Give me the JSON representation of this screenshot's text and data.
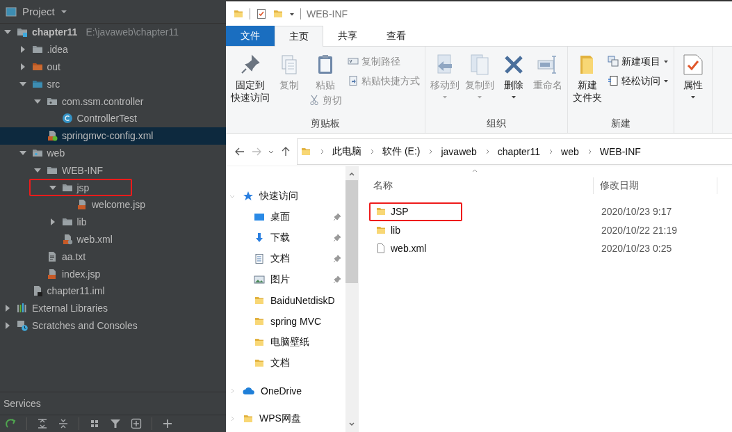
{
  "project_panel": {
    "title": "Project",
    "tree": [
      {
        "label": "chapter11",
        "path": "E:\\javaweb\\chapter11",
        "kind": "module",
        "expanded": true,
        "selected": false,
        "highlighted": false,
        "children": [
          {
            "label": ".idea",
            "kind": "folder",
            "expanded": false,
            "selected": false,
            "highlighted": false
          },
          {
            "label": "out",
            "kind": "excluded-folder",
            "expanded": false,
            "selected": false,
            "highlighted": false
          },
          {
            "label": "src",
            "kind": "source-folder",
            "expanded": true,
            "selected": false,
            "highlighted": false,
            "children": [
              {
                "label": "com.ssm.controller",
                "kind": "package",
                "expanded": true,
                "selected": false,
                "highlighted": false,
                "children": [
                  {
                    "label": "ControllerTest",
                    "kind": "class",
                    "selected": false,
                    "highlighted": false
                  }
                ]
              },
              {
                "label": "springmvc-config.xml",
                "kind": "spring-xml",
                "selected": true,
                "highlighted": false
              }
            ]
          },
          {
            "label": "web",
            "kind": "web-folder",
            "expanded": true,
            "selected": false,
            "highlighted": false,
            "children": [
              {
                "label": "WEB-INF",
                "kind": "folder",
                "expanded": true,
                "selected": false,
                "highlighted": false,
                "children": [
                  {
                    "label": "jsp",
                    "kind": "folder",
                    "expanded": true,
                    "selected": false,
                    "highlighted": true,
                    "children": [
                      {
                        "label": "welcome.jsp",
                        "kind": "jsp",
                        "selected": false,
                        "highlighted": false
                      }
                    ]
                  },
                  {
                    "label": "lib",
                    "kind": "folder",
                    "expanded": false,
                    "selected": false,
                    "highlighted": false
                  },
                  {
                    "label": "web.xml",
                    "kind": "web-xml",
                    "selected": false,
                    "highlighted": false
                  }
                ]
              },
              {
                "label": "aa.txt",
                "kind": "text",
                "selected": false,
                "highlighted": false
              },
              {
                "label": "index.jsp",
                "kind": "jsp",
                "selected": false,
                "highlighted": false
              }
            ]
          },
          {
            "label": "chapter11.iml",
            "kind": "module-file",
            "selected": false,
            "highlighted": false
          }
        ]
      },
      {
        "label": "External Libraries",
        "kind": "libraries",
        "expanded": false,
        "selected": false,
        "highlighted": false
      },
      {
        "label": "Scratches and Consoles",
        "kind": "scratches",
        "expanded": false,
        "selected": false,
        "highlighted": false
      }
    ]
  },
  "services_panel": {
    "title": "Services"
  },
  "explorer": {
    "window": {
      "title": "WEB-INF"
    },
    "ribbon_tabs": [
      {
        "label": "文件",
        "kind": "file",
        "selected": false
      },
      {
        "label": "主页",
        "kind": "tab",
        "selected": true
      },
      {
        "label": "共享",
        "kind": "tab",
        "selected": false
      },
      {
        "label": "查看",
        "kind": "tab",
        "selected": false
      }
    ],
    "ribbon_groups": [
      {
        "label": "剪贴板",
        "commands": [
          {
            "label": [
              "固定到",
              "快速访问"
            ],
            "kind": "pin",
            "disabled": false,
            "dropdown": false
          },
          {
            "label": [
              "复制"
            ],
            "kind": "copy",
            "disabled": true,
            "dropdown": false
          },
          {
            "label": [
              "粘贴"
            ],
            "kind": "paste",
            "disabled": true,
            "dropdown": false
          },
          {
            "label": [
              "剪切"
            ],
            "kind": "scissors",
            "disabled": true,
            "dropdown": false
          },
          {
            "label": [
              "复制路径"
            ],
            "kind": "copy-path",
            "disabled": true,
            "dropdown": false
          },
          {
            "label": [
              "粘贴快捷方式"
            ],
            "kind": "paste-shortcut",
            "disabled": true,
            "dropdown": false
          }
        ]
      },
      {
        "label": "组织",
        "commands": [
          {
            "label": [
              "移动到"
            ],
            "kind": "move-to",
            "disabled": true,
            "dropdown": true
          },
          {
            "label": [
              "复制到"
            ],
            "kind": "copy-to",
            "disabled": true,
            "dropdown": true
          },
          {
            "label": [
              "删除"
            ],
            "kind": "delete",
            "disabled": false,
            "dropdown": true
          },
          {
            "label": [
              "重命名"
            ],
            "kind": "rename",
            "disabled": true,
            "dropdown": false
          }
        ]
      },
      {
        "label": "新建",
        "commands": [
          {
            "label": [
              "新建",
              "文件夹"
            ],
            "kind": "new-folder",
            "disabled": false,
            "dropdown": false
          },
          {
            "label": [
              "新建项目"
            ],
            "kind": "new-item",
            "disabled": false,
            "dropdown": true
          },
          {
            "label": [
              "轻松访问"
            ],
            "kind": "easy-access",
            "disabled": false,
            "dropdown": true
          }
        ]
      },
      {
        "commands": [
          {
            "label": [
              "属性"
            ],
            "kind": "properties",
            "disabled": false,
            "dropdown": true
          }
        ]
      }
    ],
    "address": {
      "crumbs": [
        "此电脑",
        "软件 (E:)",
        "javaweb",
        "chapter11",
        "web",
        "WEB-INF"
      ]
    },
    "navigation": [
      {
        "label": "快速访问",
        "kind": "star",
        "expanded": true,
        "pinned": false
      },
      {
        "label": "桌面",
        "kind": "desktop",
        "pinned": true
      },
      {
        "label": "下载",
        "kind": "download",
        "pinned": true
      },
      {
        "label": "文档",
        "kind": "documents",
        "pinned": true
      },
      {
        "label": "图片",
        "kind": "pictures",
        "pinned": true
      },
      {
        "label": "BaiduNetdiskD",
        "kind": "folder",
        "pinned": false
      },
      {
        "label": "spring MVC",
        "kind": "folder",
        "pinned": false
      },
      {
        "label": "电脑壁纸",
        "kind": "folder",
        "pinned": false
      },
      {
        "label": "文档",
        "kind": "folder",
        "pinned": false
      },
      {
        "label": "OneDrive",
        "kind": "cloud",
        "expanded": false,
        "pinned": false
      },
      {
        "label": "WPS网盘",
        "kind": "folder",
        "expanded": false,
        "pinned": false
      }
    ],
    "columns": [
      {
        "label": "名称",
        "sorted": true
      },
      {
        "label": "修改日期",
        "sorted": false
      }
    ],
    "files": [
      {
        "name": "JSP",
        "modified": "2020/10/23 9:17",
        "kind": "folder",
        "highlighted": true
      },
      {
        "name": "lib",
        "modified": "2020/10/22 21:19",
        "kind": "folder",
        "highlighted": false
      },
      {
        "name": "web.xml",
        "modified": "2020/10/23 0:25",
        "kind": "file",
        "highlighted": false
      }
    ]
  }
}
